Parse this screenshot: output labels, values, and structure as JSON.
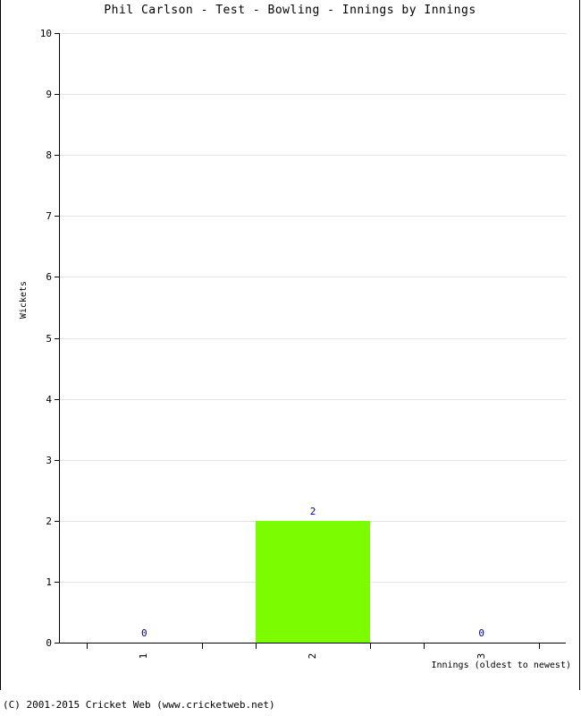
{
  "chart_data": {
    "type": "bar",
    "title": "Phil Carlson - Test - Bowling - Innings by Innings",
    "xlabel": "Innings (oldest to newest)",
    "ylabel": "Wickets",
    "categories": [
      "1",
      "2",
      "3"
    ],
    "values": [
      0,
      2,
      0
    ],
    "value_labels": [
      "0",
      "2",
      "0"
    ],
    "ylim": [
      0,
      10
    ],
    "ytick_labels": [
      "0",
      "1",
      "2",
      "3",
      "4",
      "5",
      "6",
      "7",
      "8",
      "9",
      "10"
    ],
    "ytick_values": [
      0,
      1,
      2,
      3,
      4,
      5,
      6,
      7,
      8,
      9,
      10
    ],
    "grid": "horizontal",
    "legend": "none",
    "series": [
      {
        "name": "Wickets",
        "values": [
          0,
          2,
          0
        ],
        "color": "#7CFC00"
      }
    ],
    "colors": {
      "bar": "#7CFC00",
      "value_label": "#000080",
      "gridline": "#E3E3E3",
      "axis": "#000000",
      "background": "#FFFFFF"
    }
  },
  "footer": {
    "copyright": "(C) 2001-2015 Cricket Web (www.cricketweb.net)"
  }
}
